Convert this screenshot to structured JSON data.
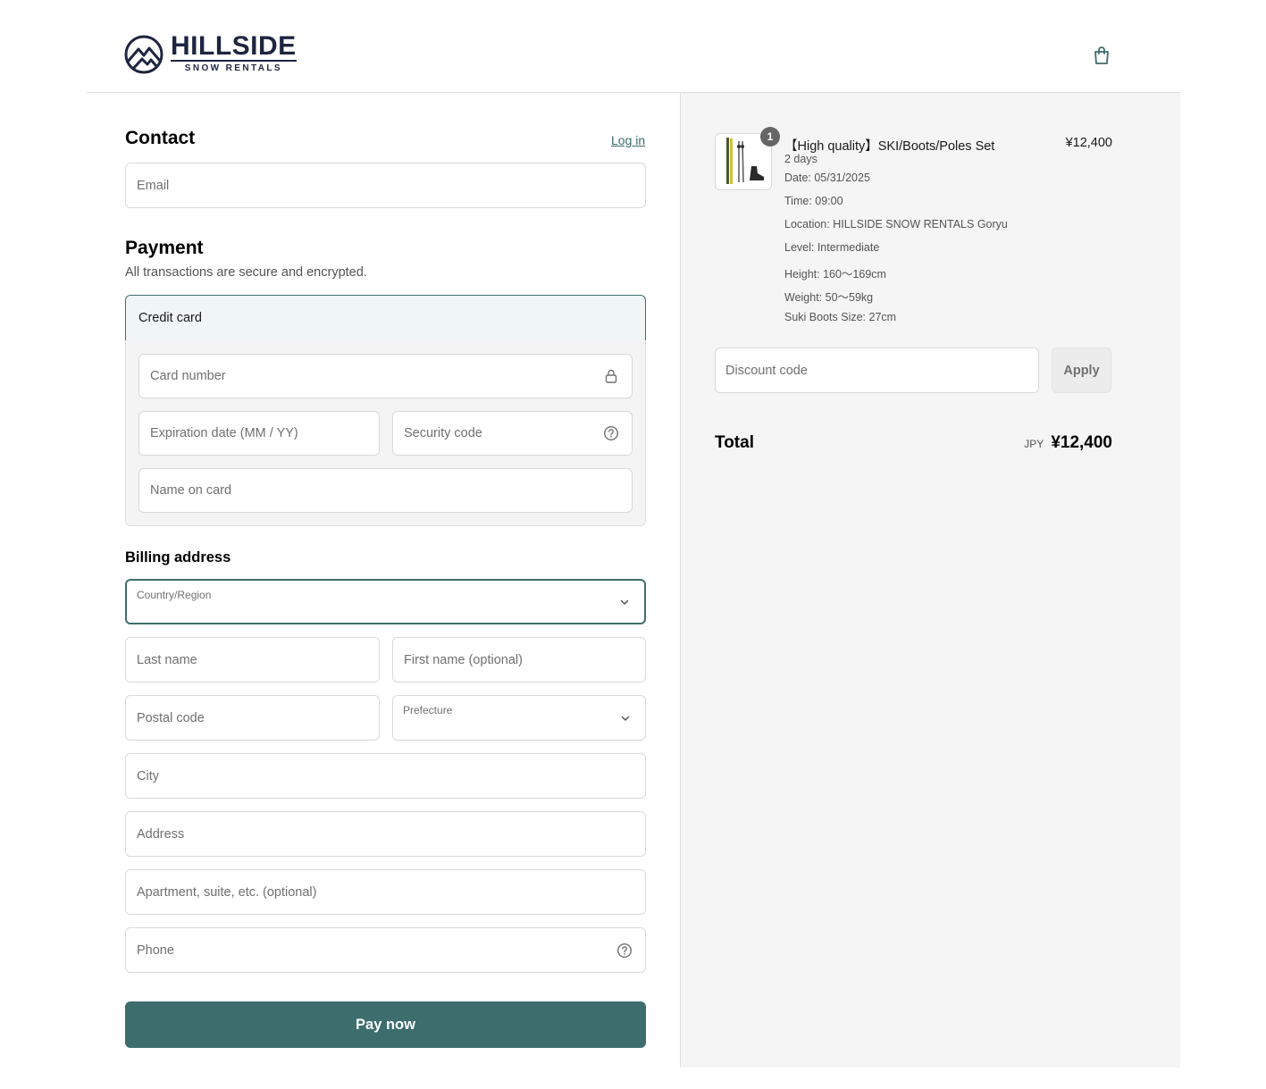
{
  "brand": {
    "name": "HILLSIDE",
    "tagline": "SNOW RENTALS"
  },
  "contact": {
    "title": "Contact",
    "login_label": "Log in",
    "email_placeholder": "Email"
  },
  "payment": {
    "title": "Payment",
    "subtitle": "All transactions are secure and encrypted.",
    "method_label": "Credit card",
    "card_number_placeholder": "Card number",
    "expiration_placeholder": "Expiration date (MM / YY)",
    "security_code_placeholder": "Security code",
    "name_on_card_placeholder": "Name on card"
  },
  "billing": {
    "title": "Billing address",
    "country_label": "Country/Region",
    "last_name_placeholder": "Last name",
    "first_name_placeholder": "First name (optional)",
    "postal_code_placeholder": "Postal code",
    "prefecture_label": "Prefecture",
    "city_placeholder": "City",
    "address_placeholder": "Address",
    "apartment_placeholder": "Apartment, suite, etc. (optional)",
    "phone_placeholder": "Phone"
  },
  "pay_now_label": "Pay now",
  "order": {
    "item": {
      "quantity": "1",
      "title": "【High quality】SKI/Boots/Poles Set",
      "price": "¥12,400",
      "duration": "2 days",
      "properties": [
        "Date: 05/31/2025",
        "Time: 09:00",
        "Location: HILLSIDE SNOW RENTALS Goryu",
        "Level: Intermediate",
        "Height: 160〜169cm",
        "Weight: 50〜59kg",
        "Suki Boots Size: 27cm"
      ]
    },
    "discount_placeholder": "Discount code",
    "apply_label": "Apply",
    "total_label": "Total",
    "total_currency": "JPY",
    "total_value": "¥12,400"
  },
  "colors": {
    "accent": "#3d6d6d",
    "brand_navy": "#1e2540",
    "summary_bg": "#f5f5f5"
  },
  "icons": [
    "mountain-logo-icon",
    "shopping-bag-icon",
    "lock-icon",
    "help-circle-icon",
    "chevron-down-icon"
  ]
}
